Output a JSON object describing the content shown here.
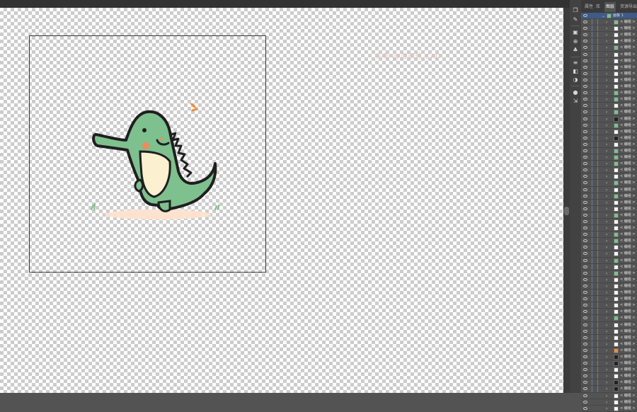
{
  "panel": {
    "tabs": [
      "属性",
      "库",
      "图层",
      "资源导出"
    ],
    "active_tab": "图层",
    "group_name": "画板 1",
    "layer_label": "< 编组 >",
    "thumbs": [
      "green",
      "white",
      "white",
      "white",
      "green",
      "white",
      "white",
      "white",
      "white",
      "white",
      "white",
      "green",
      "green",
      "white",
      "green",
      "black",
      "green",
      "white",
      "black",
      "white",
      "green",
      "green",
      "green",
      "white",
      "white",
      "green",
      "white",
      "green",
      "white",
      "white",
      "green",
      "white",
      "white",
      "green",
      "green",
      "white",
      "white",
      "green",
      "white",
      "green",
      "white",
      "white",
      "white",
      "white",
      "white",
      "white",
      "green",
      "white",
      "white",
      "white",
      "white",
      "orange",
      "black",
      "black",
      "white",
      "white",
      "black",
      "black",
      "white",
      "white",
      "white"
    ]
  },
  "canvas": {
    "watermark": "头条 @百家号 CAD"
  },
  "colors": {
    "selection": "#3f5a86",
    "accent": "#e58a3a",
    "croc_green": "#7ec08e",
    "croc_belly": "#fbf0d0"
  },
  "icons": [
    "layers-icon",
    "brush-icon",
    "shape-icon",
    "transform-icon",
    "color-icon",
    "gradient-icon",
    "adjust-icon"
  ]
}
